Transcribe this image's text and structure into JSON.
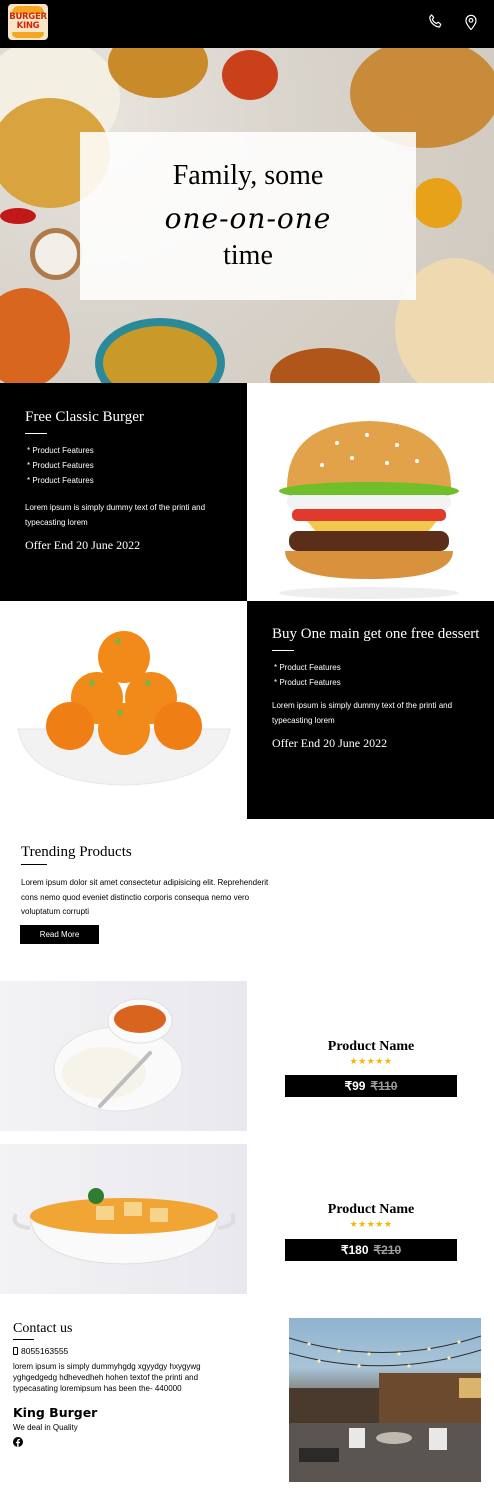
{
  "header": {
    "logo": {
      "text_line1": "BURGER",
      "text_line2": "KING"
    },
    "icons": [
      "phone-icon",
      "location-pin-icon"
    ]
  },
  "hero": {
    "line1": "Family, some",
    "line2": "one-on-one",
    "line3": "time"
  },
  "offers": [
    {
      "title": "Free Classic Burger",
      "features": [
        "* Product Features",
        "* Product Features",
        "* Product Features"
      ],
      "description": "Lorem ipsum is simply dummy text of the printi and typecasting lorem",
      "offer_end": "Offer End 20 June 2022"
    },
    {
      "title": "Buy One main get one free dessert",
      "features": [
        "* Product Features",
        "* Product Features"
      ],
      "description": "Lorem ipsum is simply dummy text of the printi and typecasting lorem",
      "offer_end": "Offer End 20 June 2022"
    }
  ],
  "trending": {
    "title": "Trending Products",
    "description": "Lorem ipsum dolor sit amet consectetur adipisicing elit. Reprehenderit cons nemo quod eveniet distinctio corporis consequa nemo vero voluptatum corrupti",
    "read_more": "Read More"
  },
  "products": [
    {
      "name": "Product Name",
      "stars": "★★★★★",
      "rating": 4.5,
      "price": "₹99",
      "old_price": "₹110"
    },
    {
      "name": "Product Name",
      "stars": "★★★★★",
      "rating": 4.5,
      "price": "₹180",
      "old_price": "₹210"
    }
  ],
  "contact": {
    "title": "Contact us",
    "phone": "8055163555",
    "address": "lorem ipsum is simply dummyhgdg xgyydgy hxygywg yghgedgedg hdhevedheh hohen textof the printi and typecasating loremipsum has been the- 440000",
    "brand": "King Burger",
    "tagline": "We deal in Quality",
    "social_icon": "facebook-icon"
  },
  "colors": {
    "header_bg": "#000000",
    "accent": "#f5b800",
    "logo_red": "#d62300",
    "logo_orange": "#f5a623"
  }
}
